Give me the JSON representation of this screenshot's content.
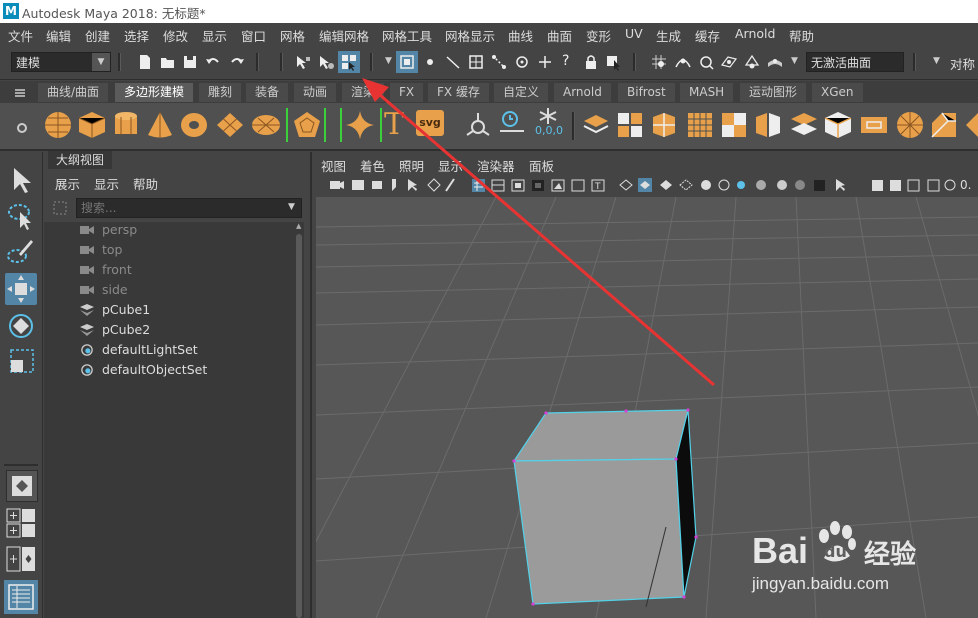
{
  "window": {
    "title": "Autodesk Maya 2018: 无标题*",
    "logo": "M"
  },
  "menubar": [
    "文件",
    "编辑",
    "创建",
    "选择",
    "修改",
    "显示",
    "窗口",
    "网格",
    "编辑网格",
    "网格工具",
    "网格显示",
    "曲线",
    "曲面",
    "变形",
    "UV",
    "生成",
    "缓存",
    "Arnold",
    "帮助"
  ],
  "statusline": {
    "mode": "建模",
    "live_surface": "无激活曲面",
    "symmetry": "对称"
  },
  "shelf_tabs": [
    "曲线/曲面",
    "多边形建模",
    "雕刻",
    "装备",
    "动画",
    "渲染",
    "FX",
    "FX 缓存",
    "自定义",
    "Arnold",
    "Bifrost",
    "MASH",
    "运动图形",
    "XGen"
  ],
  "shelf_active_tab": "多边形建模",
  "shelf_icons": [
    "poly-sphere-icon",
    "poly-cube-icon",
    "poly-cylinder-icon",
    "poly-cone-icon",
    "poly-torus-icon",
    "poly-plane-icon",
    "poly-disc-icon",
    "platonic-solid-icon",
    "super-shape-icon",
    "text-icon",
    "svg-icon",
    "svg-label",
    "snap-pivot-icon",
    "extract-icon",
    "uv-editor-icon",
    "combine-icon",
    "separate-icon",
    "smooth-icon",
    "bridge-icon",
    "booleans-icon",
    "bevel-icon",
    "extrude-icon",
    "insert-edge-loop-icon",
    "quad-draw-icon",
    "multi-cut-icon",
    "mirror-icon"
  ],
  "shelf_text": {
    "text_glyph": "T",
    "svg": "svg",
    "coord": "0,0,0"
  },
  "outliner": {
    "tab": "大纲视图",
    "menus": [
      "展示",
      "显示",
      "帮助"
    ],
    "search_placeholder": "搜索...",
    "items": [
      {
        "label": "persp",
        "icon": "camera-icon",
        "dim": true
      },
      {
        "label": "top",
        "icon": "camera-icon",
        "dim": true
      },
      {
        "label": "front",
        "icon": "camera-icon",
        "dim": true
      },
      {
        "label": "side",
        "icon": "camera-icon",
        "dim": true
      },
      {
        "label": "pCube1",
        "icon": "mesh-icon",
        "dim": false
      },
      {
        "label": "pCube2",
        "icon": "mesh-icon",
        "dim": false
      },
      {
        "label": "defaultLightSet",
        "icon": "set-icon",
        "dim": false
      },
      {
        "label": "defaultObjectSet",
        "icon": "set-icon",
        "dim": false
      }
    ]
  },
  "viewport": {
    "menus": [
      "视图",
      "着色",
      "照明",
      "显示",
      "渲染器",
      "面板"
    ],
    "exposure": "0.",
    "watermark": {
      "brand": "Bai",
      "brand2": "du",
      "cn": "经验",
      "url": "jingyan.baidu.com"
    }
  },
  "colors": {
    "accent": "#5285a6",
    "shelf_icon": "#e8a14a",
    "selection": "#53d1e8",
    "annotation": "#e83333"
  }
}
